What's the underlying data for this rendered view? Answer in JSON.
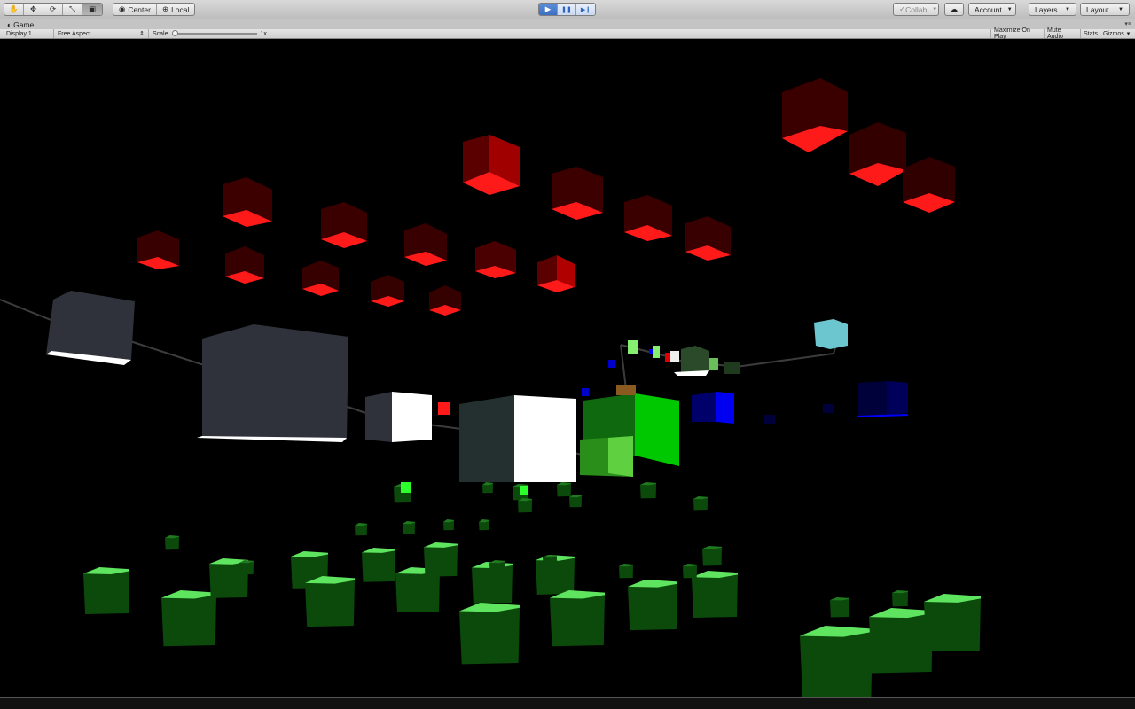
{
  "toolbar": {
    "tools": [
      {
        "name": "hand-tool",
        "glyph": "✋"
      },
      {
        "name": "move-tool",
        "glyph": "✥"
      },
      {
        "name": "rotate-tool",
        "glyph": "⟳"
      },
      {
        "name": "scale-tool",
        "glyph": "⤡"
      },
      {
        "name": "rect-tool",
        "glyph": "▣"
      }
    ],
    "active_tool": 4,
    "pivot_label": "Center",
    "pivot_rotation_label": "Local",
    "play_glyph": "▶",
    "pause_glyph": "❚❚",
    "step_glyph": "▶❙",
    "collab_label": "Collab",
    "cloud_glyph": "☁",
    "account_label": "Account",
    "layers_label": "Layers",
    "layout_label": "Layout"
  },
  "game_tab": {
    "title": "Game",
    "options_glyph": "▾≡"
  },
  "game_bar": {
    "display": "Display 1",
    "aspect": "Free Aspect",
    "scale_label": "Scale",
    "scale_value": "1x",
    "maximize_on_play": "Maximize On Play",
    "mute_audio": "Mute Audio",
    "stats": "Stats",
    "gizmos": "Gizmos"
  },
  "colors": {
    "red": "#c40000",
    "green": "#1f8f1f",
    "blue": "#0000c8",
    "cyan": "#6cc6d0",
    "gray": "#3a3d46",
    "white": "#ffffff"
  }
}
